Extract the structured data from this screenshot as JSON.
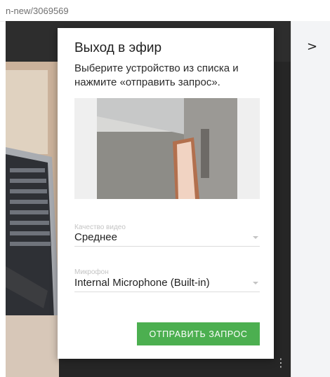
{
  "browser": {
    "url_fragment": "n-new/3069569"
  },
  "modal": {
    "title": "Выход в эфир",
    "description": "Выберите устройство из списка и нажмите «отправить запрос».",
    "video_quality": {
      "label": "Качество видео",
      "value": "Среднее"
    },
    "microphone": {
      "label": "Микрофон",
      "value": "Internal Microphone (Built-in)"
    },
    "submit_label": "ОТПРАВИТЬ ЗАПРОС"
  },
  "sidepanel": {
    "toggle_icon": "chevron-right-icon",
    "toggle_glyph": ">"
  },
  "stage": {
    "menu_icon": "kebab-menu-icon",
    "menu_glyph": "⋮"
  },
  "colors": {
    "accent": "#4caf50",
    "stage_bg": "#262626",
    "panel_bg": "#f3f4f6"
  }
}
